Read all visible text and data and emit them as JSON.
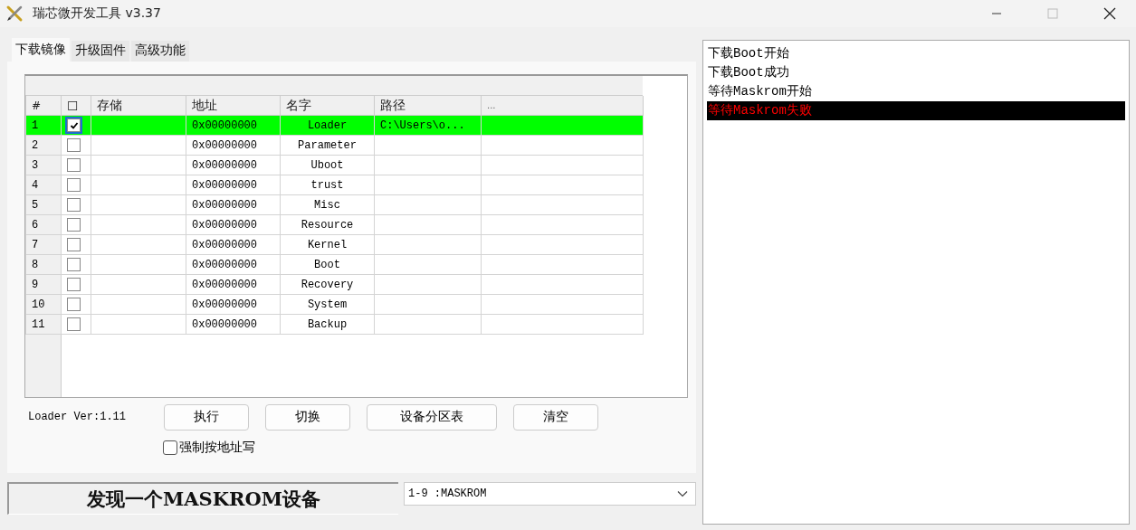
{
  "window": {
    "title": "瑞芯微开发工具 v3.37"
  },
  "tabs": [
    {
      "label": "下载镜像",
      "selected": true
    },
    {
      "label": "升级固件",
      "selected": false
    },
    {
      "label": "高级功能",
      "selected": false
    }
  ],
  "table": {
    "columns": [
      "#",
      "☐",
      "存储",
      "地址",
      "名字",
      "路径",
      "..."
    ],
    "rows": [
      {
        "index": "1",
        "checked": true,
        "selected": true,
        "address": "0x00000000",
        "name": "Loader",
        "path": "C:\\Users\\o..."
      },
      {
        "index": "2",
        "checked": false,
        "selected": false,
        "address": "0x00000000",
        "name": "Parameter"
      },
      {
        "index": "3",
        "checked": false,
        "selected": false,
        "address": "0x00000000",
        "name": "Uboot"
      },
      {
        "index": "4",
        "checked": false,
        "selected": false,
        "address": "0x00000000",
        "name": "trust"
      },
      {
        "index": "5",
        "checked": false,
        "selected": false,
        "address": "0x00000000",
        "name": "Misc"
      },
      {
        "index": "6",
        "checked": false,
        "selected": false,
        "address": "0x00000000",
        "name": "Resource"
      },
      {
        "index": "7",
        "checked": false,
        "selected": false,
        "address": "0x00000000",
        "name": "Kernel"
      },
      {
        "index": "8",
        "checked": false,
        "selected": false,
        "address": "0x00000000",
        "name": "Boot"
      },
      {
        "index": "9",
        "checked": false,
        "selected": false,
        "address": "0x00000000",
        "name": "Recovery"
      },
      {
        "index": "10",
        "checked": false,
        "selected": false,
        "address": "0x00000000",
        "name": "System"
      },
      {
        "index": "11",
        "checked": false,
        "selected": false,
        "address": "0x00000000",
        "name": "Backup"
      }
    ]
  },
  "loader_version": "Loader Ver:1.11",
  "buttons": [
    "执行",
    "切换",
    "设备分区表",
    "清空"
  ],
  "force_address_write": {
    "label": "强制按地址写",
    "checked": false
  },
  "status": "发现一个MASKROM设备",
  "device_select": {
    "value": "1-9 :MASKROM"
  },
  "log": [
    {
      "text": "下载Boot开始",
      "kind": "info"
    },
    {
      "text": "下载Boot成功",
      "kind": "info"
    },
    {
      "text": "等待Maskrom开始",
      "kind": "info"
    },
    {
      "text": "等待Maskrom失败",
      "kind": "error"
    }
  ]
}
